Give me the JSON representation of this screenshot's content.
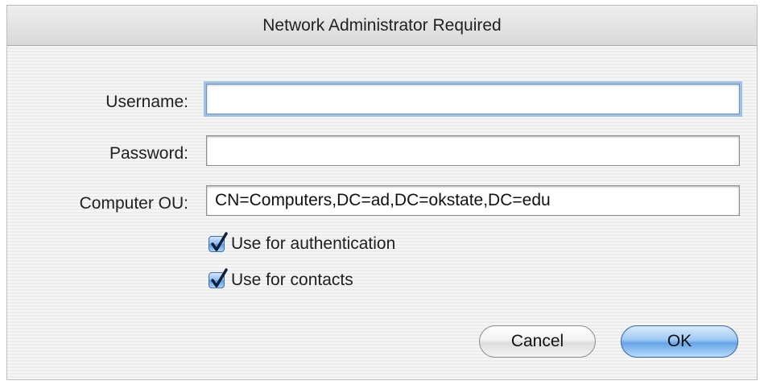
{
  "dialog": {
    "title": "Network Administrator Required"
  },
  "form": {
    "username": {
      "label": "Username:",
      "value": ""
    },
    "password": {
      "label": "Password:",
      "value": ""
    },
    "computer_ou": {
      "label": "Computer OU:",
      "value": "CN=Computers,DC=ad,DC=okstate,DC=edu"
    }
  },
  "options": {
    "use_for_authentication": {
      "label": "Use for authentication",
      "checked": true
    },
    "use_for_contacts": {
      "label": "Use for contacts",
      "checked": true
    }
  },
  "buttons": {
    "cancel_label": "Cancel",
    "ok_label": "OK"
  },
  "colors": {
    "focus_ring": "#9ec1e6",
    "default_button": "#66a4e8",
    "checkbox": "#5d9be4"
  },
  "icons": {
    "checkmark": "checkmark-icon"
  }
}
